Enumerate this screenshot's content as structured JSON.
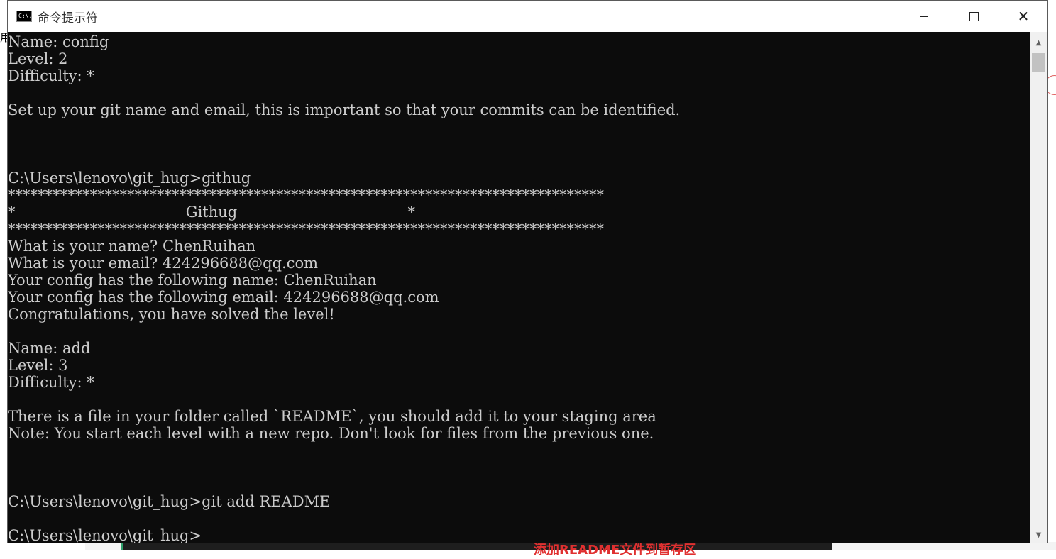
{
  "window": {
    "title": "命令提示符",
    "icon_label": "C:\\."
  },
  "backdrop": {
    "left_char": "用",
    "bottom_text": "添加README文件到暂存区"
  },
  "console": {
    "lines": [
      "Name: config",
      "Level: 2",
      "Difficulty: *",
      "",
      "Set up your git name and email, this is important so that your commits can be identified.",
      "",
      "",
      "",
      "C:\\Users\\lenovo\\git_hug>githug",
      "********************************************************************************",
      "*                                    Githug                                    *",
      "********************************************************************************",
      "What is your name? ChenRuihan",
      "What is your email? 424296688@qq.com",
      "Your config has the following name: ChenRuihan",
      "Your config has the following email: 424296688@qq.com",
      "Congratulations, you have solved the level!",
      "",
      "Name: add",
      "Level: 3",
      "Difficulty: *",
      "",
      "There is a file in your folder called `README`, you should add it to your staging area",
      "Note: You start each level with a new repo. Don't look for files from the previous one.",
      "",
      "",
      "",
      "C:\\Users\\lenovo\\git_hug>git add README",
      "",
      "C:\\Users\\lenovo\\git_hug>"
    ]
  },
  "icons": {
    "minimize": "minimize-icon",
    "maximize": "maximize-icon",
    "close": "close-icon",
    "scroll_up": "scroll-up-arrow-icon",
    "scroll_down": "scroll-down-arrow-icon"
  },
  "colors": {
    "console_bg": "#0c0c0c",
    "console_fg": "#cccccc",
    "titlebar_bg": "#ffffff"
  }
}
